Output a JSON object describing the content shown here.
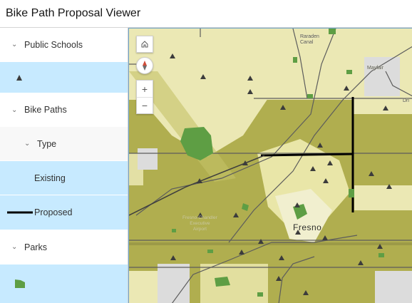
{
  "app": {
    "title": "Bike Path Proposal Viewer"
  },
  "legend": {
    "public_schools": "Public Schools",
    "bike_paths": "Bike Paths",
    "type": "Type",
    "existing": "Existing",
    "proposed": "Proposed",
    "parks": "Parks"
  },
  "map": {
    "city": "Fresno",
    "place_north": "Raraden\nCanal",
    "place_mayfair": "Mayfair",
    "place_east": "Dri",
    "airport": "Fresno-Chandler\nExecutive\nAirport",
    "controls": {
      "home_icon": "home-icon",
      "compass_icon": "compass-icon",
      "zoom_in": "+",
      "zoom_out": "−"
    }
  },
  "colors": {
    "accent_selected": "#c7eaff",
    "map_dark_olive": "#b0ae4f",
    "map_light": "#ebe8b4",
    "map_palest": "#f3f1d6",
    "park_green": "#5e9e44",
    "proposed_path": "#000000"
  }
}
